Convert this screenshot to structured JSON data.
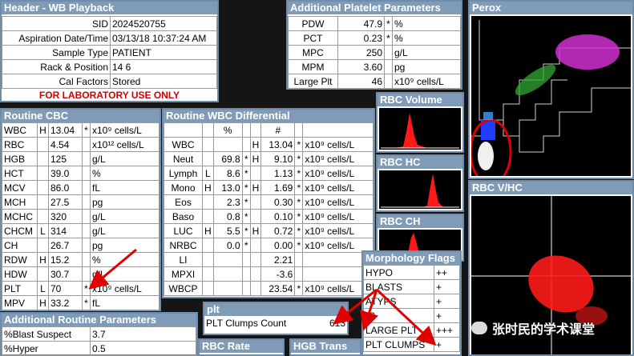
{
  "header": {
    "title": "Header - WB   Playback",
    "rows": [
      {
        "label": "SID",
        "value": "2024520755"
      },
      {
        "label": "Aspiration Date/Time",
        "value": "03/13/18 10:37:24 AM"
      },
      {
        "label": "Sample Type",
        "value": "PATIENT"
      },
      {
        "label": "Rack & Position",
        "value": "14 6"
      },
      {
        "label": "Cal Factors",
        "value": "Stored"
      }
    ],
    "lab_note": "FOR LABORATORY USE ONLY"
  },
  "platelet": {
    "title": "Additional Platelet Parameters",
    "rows": [
      {
        "label": "PDW",
        "value": "47.9",
        "flag": "*",
        "unit": "%"
      },
      {
        "label": "PCT",
        "value": "0.23",
        "flag": "*",
        "unit": "%"
      },
      {
        "label": "MPC",
        "value": "250",
        "flag": "",
        "unit": "g/L"
      },
      {
        "label": "MPM",
        "value": "3.60",
        "flag": "",
        "unit": "pg"
      },
      {
        "label": "Large Plt",
        "value": "46",
        "flag": "",
        "unit": "x10⁹ cells/L"
      }
    ]
  },
  "perox": {
    "title": "Perox"
  },
  "cbc": {
    "title": "Routine CBC",
    "rows": [
      {
        "label": "WBC",
        "hl": "H",
        "value": "13.04",
        "flag": "*",
        "unit": "x10⁹ cells/L"
      },
      {
        "label": "RBC",
        "hl": "",
        "value": "4.54",
        "flag": "",
        "unit": "x10¹² cells/L"
      },
      {
        "label": "HGB",
        "hl": "",
        "value": "125",
        "flag": "",
        "unit": "g/L"
      },
      {
        "label": "HCT",
        "hl": "",
        "value": "39.0",
        "flag": "",
        "unit": "%"
      },
      {
        "label": "MCV",
        "hl": "",
        "value": "86.0",
        "flag": "",
        "unit": "fL"
      },
      {
        "label": "MCH",
        "hl": "",
        "value": "27.5",
        "flag": "",
        "unit": "pg"
      },
      {
        "label": "MCHC",
        "hl": "",
        "value": "320",
        "flag": "",
        "unit": "g/L"
      },
      {
        "label": "CHCM",
        "hl": "L",
        "value": "314",
        "flag": "",
        "unit": "g/L"
      },
      {
        "label": "CH",
        "hl": "",
        "value": "26.7",
        "flag": "",
        "unit": "pg"
      },
      {
        "label": "RDW",
        "hl": "H",
        "value": "15.2",
        "flag": "",
        "unit": "%"
      },
      {
        "label": "HDW",
        "hl": "",
        "value": "30.7",
        "flag": "",
        "unit": "g/L"
      },
      {
        "label": "PLT",
        "hl": "L",
        "value": "70",
        "flag": "*",
        "unit": "x10⁹ cells/L"
      },
      {
        "label": "MPV",
        "hl": "H",
        "value": "33.2",
        "flag": "*",
        "unit": "fL"
      }
    ]
  },
  "diff": {
    "title": "Routine WBC Differential",
    "col_pct": "%",
    "col_num": "#",
    "rows": [
      {
        "label": "WBC",
        "hl1": "",
        "pct": "",
        "f1": "",
        "hl2": "H",
        "num": "13.04",
        "f2": "*",
        "unit": "x10⁹ cells/L"
      },
      {
        "label": "Neut",
        "hl1": "",
        "pct": "69.8",
        "f1": "*",
        "hl2": "H",
        "num": "9.10",
        "f2": "*",
        "unit": "x10⁹ cells/L"
      },
      {
        "label": "Lymph",
        "hl1": "L",
        "pct": "8.6",
        "f1": "*",
        "hl2": "",
        "num": "1.13",
        "f2": "*",
        "unit": "x10⁹ cells/L"
      },
      {
        "label": "Mono",
        "hl1": "H",
        "pct": "13.0",
        "f1": "*",
        "hl2": "H",
        "num": "1.69",
        "f2": "*",
        "unit": "x10⁹ cells/L"
      },
      {
        "label": "Eos",
        "hl1": "",
        "pct": "2.3",
        "f1": "*",
        "hl2": "",
        "num": "0.30",
        "f2": "*",
        "unit": "x10⁹ cells/L"
      },
      {
        "label": "Baso",
        "hl1": "",
        "pct": "0.8",
        "f1": "*",
        "hl2": "",
        "num": "0.10",
        "f2": "*",
        "unit": "x10⁹ cells/L"
      },
      {
        "label": "LUC",
        "hl1": "H",
        "pct": "5.5",
        "f1": "*",
        "hl2": "H",
        "num": "0.72",
        "f2": "*",
        "unit": "x10⁹ cells/L"
      },
      {
        "label": "NRBC",
        "hl1": "",
        "pct": "0.0",
        "f1": "*",
        "hl2": "",
        "num": "0.00",
        "f2": "*",
        "unit": "x10⁹ cells/L"
      },
      {
        "label": "LI",
        "hl1": "",
        "pct": "",
        "f1": "",
        "hl2": "",
        "num": "2.21",
        "f2": "",
        "unit": ""
      },
      {
        "label": "MPXI",
        "hl1": "",
        "pct": "",
        "f1": "",
        "hl2": "",
        "num": "-3.6",
        "f2": "",
        "unit": ""
      },
      {
        "label": "WBCP",
        "hl1": "",
        "pct": "",
        "f1": "",
        "hl2": "",
        "num": "23.54",
        "f2": "*",
        "unit": "x10⁹ cells/L"
      }
    ]
  },
  "rbc_volume": {
    "title": "RBC Volume"
  },
  "rbc_hc": {
    "title": "RBC HC"
  },
  "rbc_ch": {
    "title": "RBC CH"
  },
  "rbc_vhc": {
    "title": "RBC V/HC"
  },
  "morph": {
    "title": "Morphology Flags",
    "rows": [
      {
        "label": "HYPO",
        "value": "++"
      },
      {
        "label": "BLASTS",
        "value": "+"
      },
      {
        "label": "ATYPS",
        "value": "+"
      },
      {
        "label": "IG",
        "value": "+"
      },
      {
        "label": "LARGE PLT",
        "value": "+++"
      },
      {
        "label": "PLT CLUMPS",
        "value": "+"
      }
    ]
  },
  "plt_panel": {
    "title": "plt",
    "label": "PLT Clumps Count",
    "value": "613"
  },
  "add_routine": {
    "title": "Additional Routine Parameters",
    "rows": [
      {
        "label": "%Blast Suspect",
        "value": "3.7"
      },
      {
        "label": "%Hyper",
        "value": "0.5"
      }
    ]
  },
  "rbc_rate": {
    "title": "RBC Rate"
  },
  "hgb_trans": {
    "title": "HGB Trans"
  },
  "watermark": {
    "text": "张时民的学术课堂"
  },
  "colors": {
    "panel_title": "#7f9bb8",
    "border": "#6f8daa",
    "annotation_red": "#e00000"
  }
}
